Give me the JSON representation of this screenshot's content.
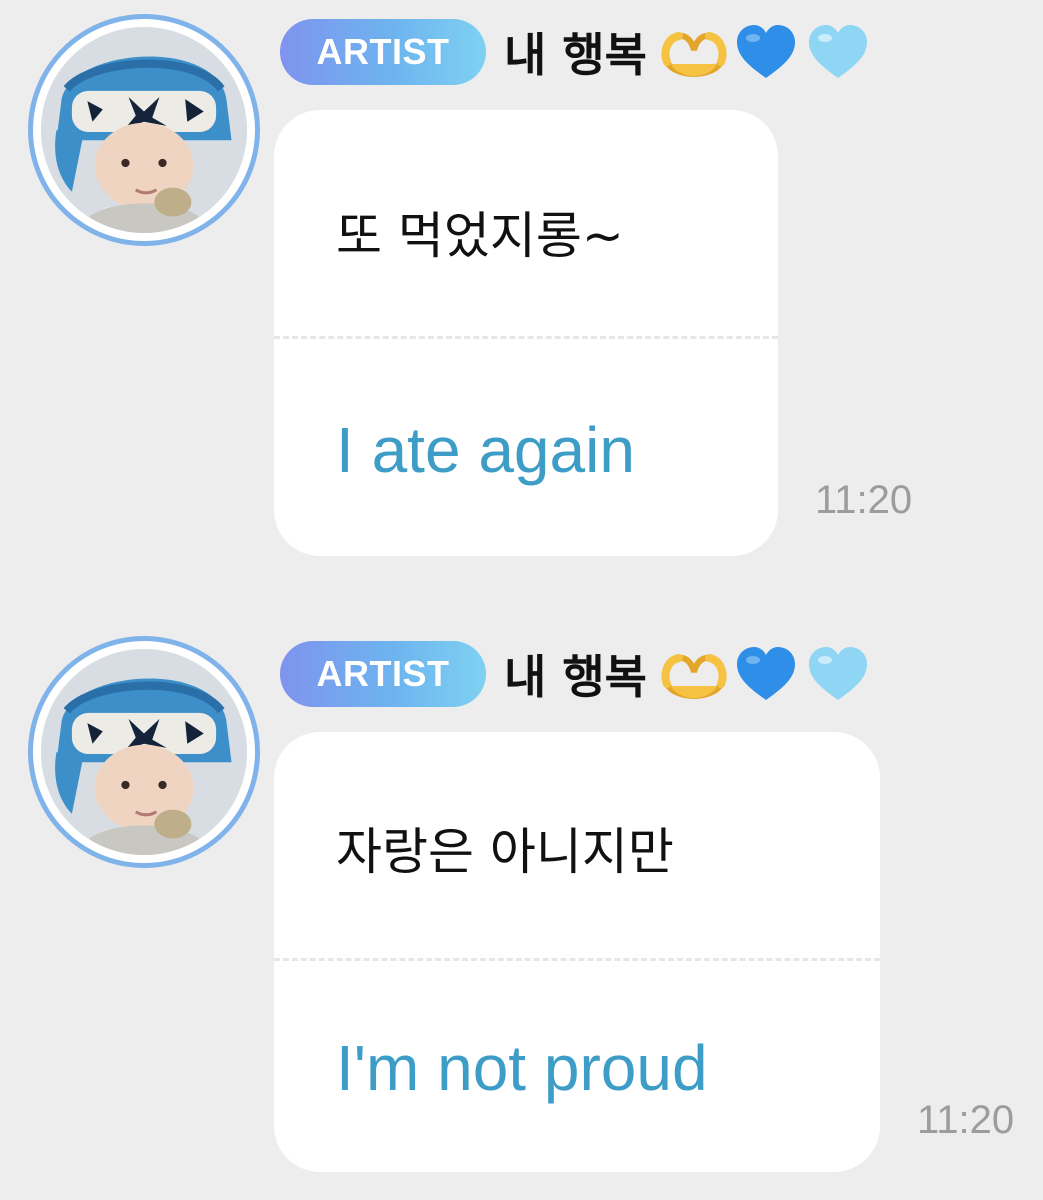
{
  "messages": [
    {
      "badge": "ARTIST",
      "sender": "내 행복",
      "sender_emojis": [
        "heart-hands-emoji",
        "blue-heart-emoji",
        "light-blue-heart-emoji"
      ],
      "original_text": "또 먹었지롱~",
      "translated_text": "I ate again",
      "time": "11:20"
    },
    {
      "badge": "ARTIST",
      "sender": "내 행복",
      "sender_emojis": [
        "heart-hands-emoji",
        "blue-heart-emoji",
        "light-blue-heart-emoji"
      ],
      "original_text": "자랑은 아니지만",
      "translated_text": "I'm not proud",
      "time": "11:20"
    }
  ],
  "colors": {
    "background": "#ededed",
    "badge_gradient_start": "#7f93ee",
    "badge_gradient_end": "#7fd1f2",
    "translation_text": "#3d9dc7",
    "avatar_ring": "#7fb3ea"
  }
}
